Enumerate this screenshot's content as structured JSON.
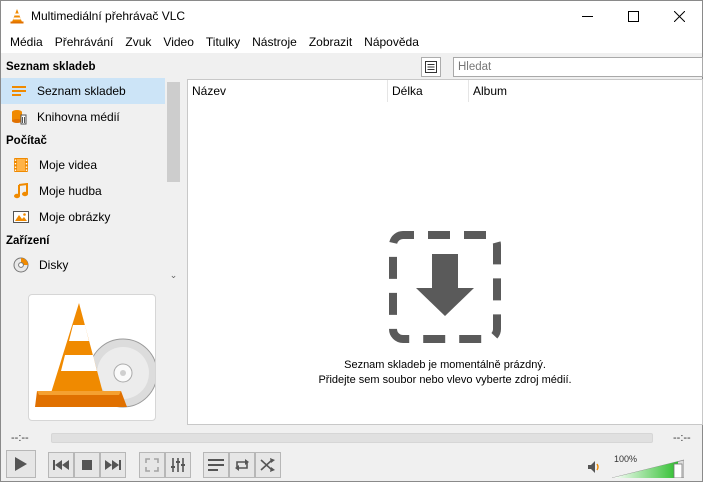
{
  "window": {
    "title": "Multimediální přehrávač VLC"
  },
  "menu": [
    "Média",
    "Přehrávání",
    "Zvuk",
    "Video",
    "Titulky",
    "Nástroje",
    "Zobrazit",
    "Nápověda"
  ],
  "sidebar": {
    "sections": [
      {
        "title": "Seznam skladeb",
        "items": [
          {
            "label": "Seznam skladeb",
            "icon": "playlist-icon",
            "active": true
          },
          {
            "label": "Knihovna médií",
            "icon": "media-library-icon",
            "active": false
          }
        ]
      },
      {
        "title": "Počítač",
        "items": [
          {
            "label": "Moje videa",
            "icon": "film-icon",
            "active": false
          },
          {
            "label": "Moje hudba",
            "icon": "music-note-icon",
            "active": false
          },
          {
            "label": "Moje obrázky",
            "icon": "picture-icon",
            "active": false
          }
        ]
      },
      {
        "title": "Zařízení",
        "items": [
          {
            "label": "Disky",
            "icon": "disc-icon",
            "active": false
          }
        ]
      }
    ]
  },
  "search": {
    "placeholder": "Hledat"
  },
  "playlist": {
    "columns": [
      "Název",
      "Délka",
      "Album"
    ],
    "empty_line1": "Seznam skladeb je momentálně prázdný.",
    "empty_line2": "Přidejte sem soubor nebo vlevo vyberte zdroj médií."
  },
  "seek": {
    "elapsed": "--:--",
    "remaining": "--:--",
    "progress": 0
  },
  "volume": {
    "label": "100%",
    "level": 1.0
  },
  "colors": {
    "accent": "#cce4f7",
    "volume_green": "#3cc43c",
    "cone_orange": "#f08a00"
  }
}
